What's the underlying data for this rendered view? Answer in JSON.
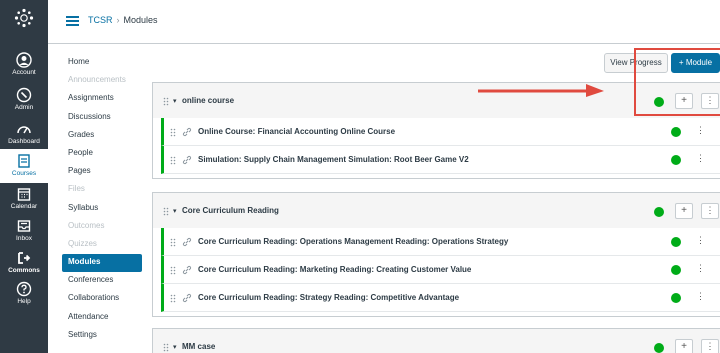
{
  "global_nav": {
    "items": [
      {
        "label": "Account",
        "icon": "account-icon"
      },
      {
        "label": "Admin",
        "icon": "admin-icon"
      },
      {
        "label": "Dashboard",
        "icon": "dashboard-icon"
      },
      {
        "label": "Courses",
        "icon": "courses-icon",
        "active": true
      },
      {
        "label": "Calendar",
        "icon": "calendar-icon"
      },
      {
        "label": "Inbox",
        "icon": "inbox-icon"
      },
      {
        "label": "Commons",
        "icon": "commons-icon"
      },
      {
        "label": "Help",
        "icon": "help-icon"
      }
    ]
  },
  "breadcrumb": {
    "course": "TCSR",
    "separator": "›",
    "current": "Modules"
  },
  "course_nav": {
    "items": [
      {
        "label": "Home",
        "state": "normal"
      },
      {
        "label": "Announcements",
        "state": "disabled"
      },
      {
        "label": "Assignments",
        "state": "normal"
      },
      {
        "label": "Discussions",
        "state": "normal"
      },
      {
        "label": "Grades",
        "state": "normal"
      },
      {
        "label": "People",
        "state": "normal"
      },
      {
        "label": "Pages",
        "state": "normal"
      },
      {
        "label": "Files",
        "state": "disabled"
      },
      {
        "label": "Syllabus",
        "state": "normal"
      },
      {
        "label": "Outcomes",
        "state": "disabled"
      },
      {
        "label": "Quizzes",
        "state": "disabled"
      },
      {
        "label": "Modules",
        "state": "active"
      },
      {
        "label": "Conferences",
        "state": "normal"
      },
      {
        "label": "Collaborations",
        "state": "normal"
      },
      {
        "label": "Attendance",
        "state": "normal"
      },
      {
        "label": "Settings",
        "state": "normal"
      }
    ]
  },
  "toolbar": {
    "view_progress_label": "View Progress",
    "add_module_label": "+ Module"
  },
  "modules": [
    {
      "title": "online course",
      "items": [
        "Online Course: Financial Accounting Online Course",
        "Simulation: Supply Chain Management Simulation: Root Beer Game V2"
      ]
    },
    {
      "title": "Core Curriculum Reading",
      "items": [
        "Core Curriculum Reading: Operations Management Reading: Operations Strategy",
        "Core Curriculum Reading: Marketing Reading: Creating Customer Value",
        "Core Curriculum Reading: Strategy Reading: Competitive Advantage"
      ]
    },
    {
      "title": "MM case",
      "items": []
    }
  ],
  "glyphs": {
    "caret": "▾",
    "plus": "+",
    "kebab": "⋮"
  },
  "colors": {
    "brand": "#0770a3",
    "nav_bg": "#2f3a44",
    "success": "#00ac18",
    "annotation": "#e04a3f"
  }
}
